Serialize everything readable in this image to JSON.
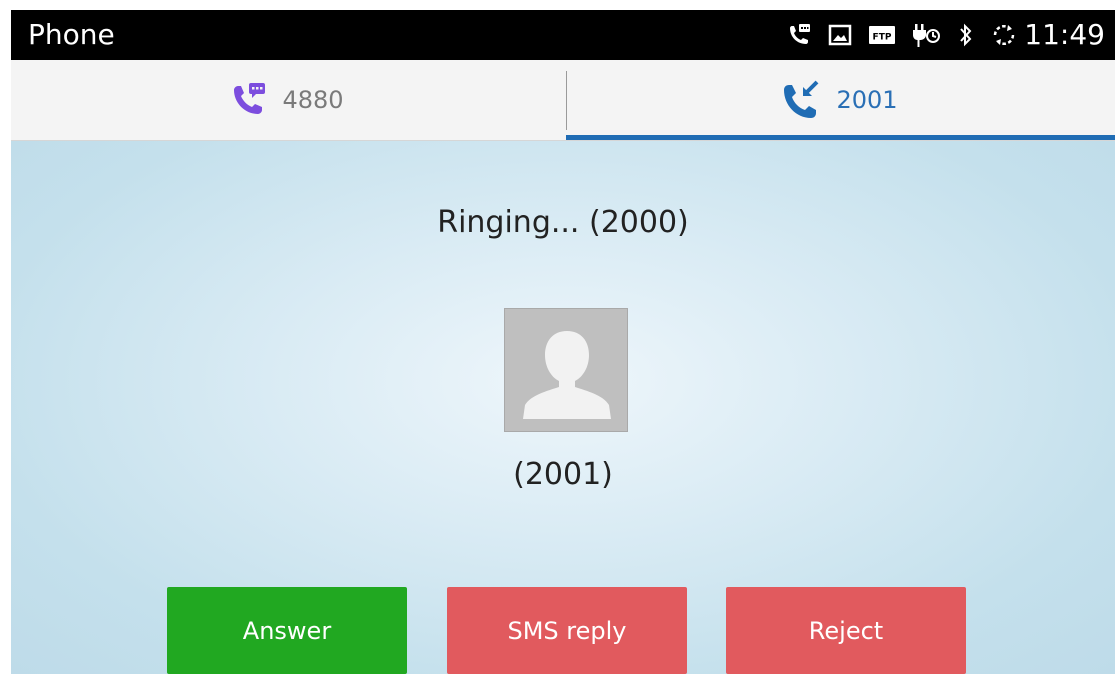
{
  "statusbar": {
    "app_title": "Phone",
    "time": "11:49",
    "icons": [
      "call-message-icon",
      "image-icon",
      "ftp-icon",
      "usb-debug-icon",
      "bluetooth-icon",
      "sync-icon"
    ],
    "ftp_label": "FTP"
  },
  "tabs": [
    {
      "label": "4880",
      "icon": "call-message-icon",
      "active": false,
      "color": "#7c4dde"
    },
    {
      "label": "2001",
      "icon": "incoming-call-icon",
      "active": true,
      "color": "#1f6cb4"
    }
  ],
  "call": {
    "status_text": "Ringing... (2000)",
    "caller_number": "(2001)",
    "avatar_icon": "person-silhouette-icon"
  },
  "buttons": {
    "answer": "Answer",
    "sms_reply": "SMS reply",
    "reject": "Reject"
  },
  "colors": {
    "answer": "#21a821",
    "reject": "#e15a5e",
    "accent": "#1f6cb4",
    "statusbar": "#000000"
  }
}
